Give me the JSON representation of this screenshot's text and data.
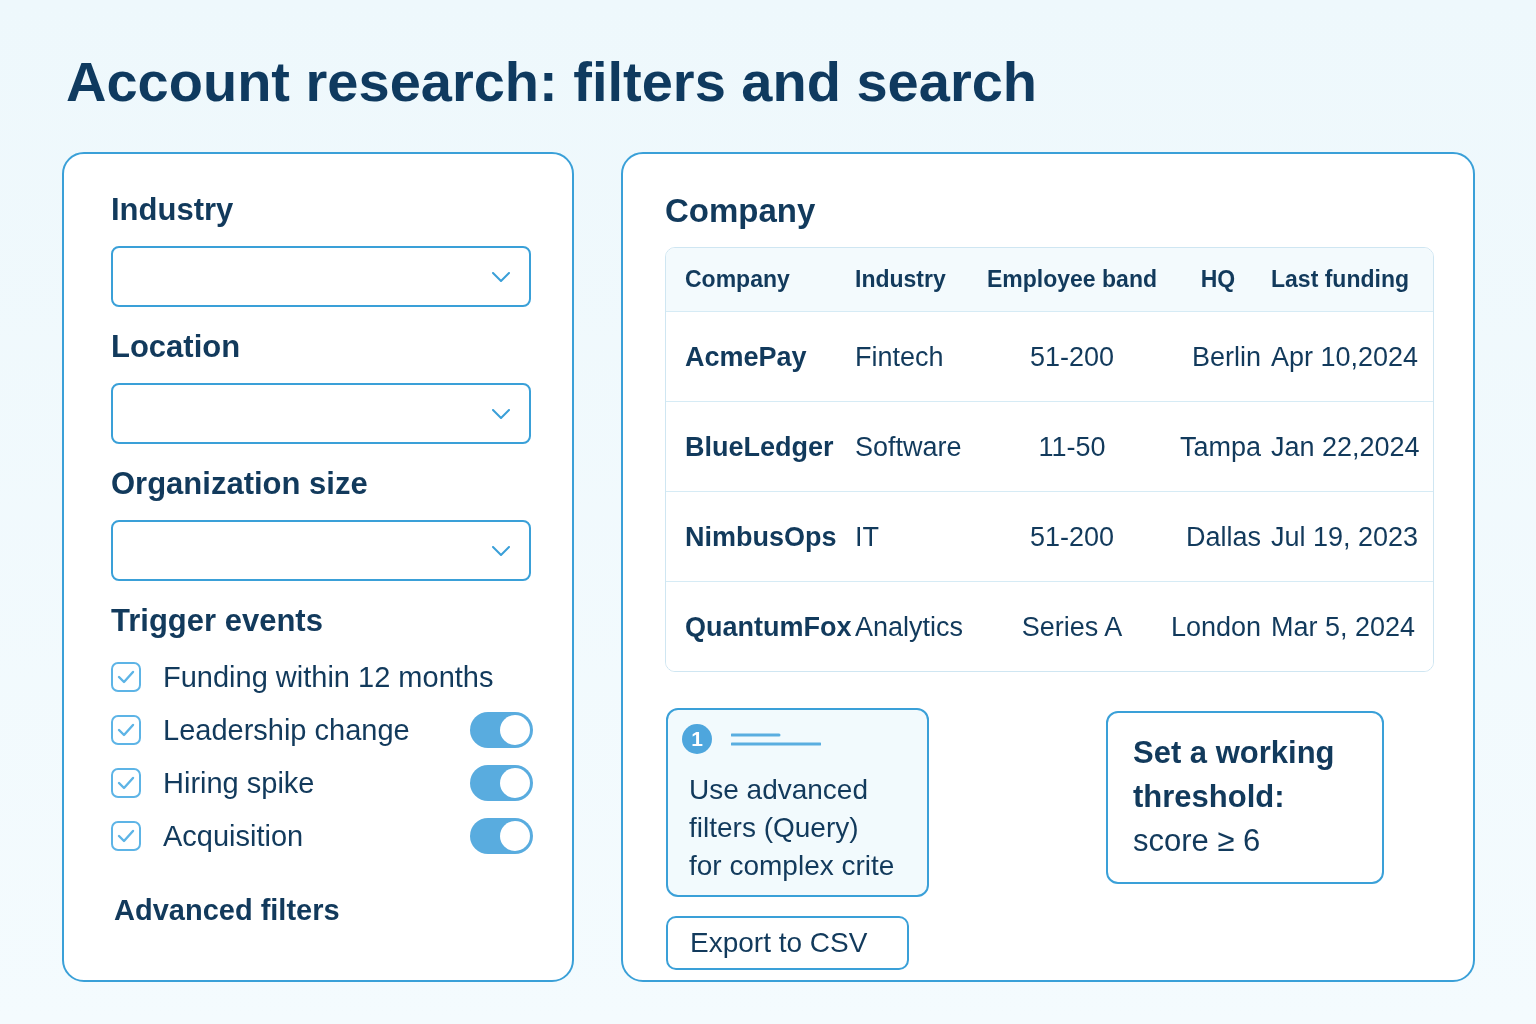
{
  "title": "Account research: filters and search",
  "filters": {
    "selects": [
      {
        "label": "Industry"
      },
      {
        "label": "Location"
      },
      {
        "label": "Organization size"
      }
    ],
    "trigger_events": {
      "label": "Trigger events",
      "items": [
        {
          "label": "Funding within 12 months",
          "checked": true
        },
        {
          "label": "Leadership change",
          "checked": true,
          "switch_on": true
        },
        {
          "label": "Hiring spike",
          "checked": true,
          "switch_on": true
        },
        {
          "label": "Acquisition",
          "checked": true,
          "switch_on": true
        }
      ]
    },
    "advanced_filters": "Advanced filters"
  },
  "results": {
    "heading": "Company",
    "table": {
      "columns": [
        "Company",
        "Industry",
        "Employee band",
        "HQ",
        "Last funding"
      ],
      "rows": [
        [
          "AcmePay",
          "Fintech",
          "51-200",
          "Berlin",
          "Apr 10,2024"
        ],
        [
          "BlueLedger",
          "Software",
          "11-50",
          "Tampa",
          "Jan 22,2024"
        ],
        [
          "NimbusOps",
          "IT",
          "51-200",
          "Dallas",
          "Jul 19, 2023"
        ],
        [
          "QuantumFox",
          "Analytics",
          "Series A",
          "London",
          "Mar 5, 2024"
        ]
      ]
    }
  },
  "hint": {
    "number": "1",
    "text": "Use advanced filters (Query) for complex crite"
  },
  "export_button": "Export to CSV",
  "threshold_note": "**Set a working threshold:** score ≥ 6"
}
